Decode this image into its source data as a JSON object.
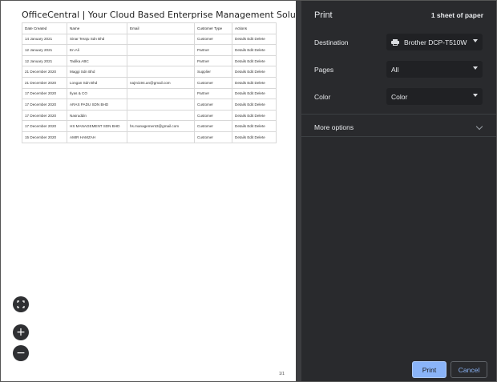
{
  "document": {
    "title": "OfficeCentral | Your Cloud Based Enterprise Management Solution",
    "columns": [
      "Date Created",
      "Name",
      "Email",
      "Customer Type",
      "Actions"
    ],
    "rows": [
      [
        "14 January 2021",
        "Sinar Teraju Sdn Bhd",
        "",
        "Customer",
        "Details Edit Delete"
      ],
      [
        "12 January 2021",
        "En Ali",
        "",
        "Partner",
        "Details Edit Delete"
      ],
      [
        "12 January 2021",
        "Tadika ABC",
        "",
        "Partner",
        "Details Edit Delete"
      ],
      [
        "21 December 2020",
        "Maggi Sdn Bhd",
        "",
        "Supplier",
        "Details Edit Delete"
      ],
      [
        "21 December 2020",
        "Longan Sdn Bhd",
        "najmi194.an@gmail.com",
        "Customer",
        "Details Edit Delete"
      ],
      [
        "17 December 2020",
        "Ilyas & CO",
        "",
        "Partner",
        "Details Edit Delete"
      ],
      [
        "17 December 2020",
        "ARAS PADU SDN BHD",
        "",
        "Customer",
        "Details Edit Delete"
      ],
      [
        "17 December 2020",
        "Nasruddin",
        "",
        "Customer",
        "Details Edit Delete"
      ],
      [
        "17 December 2020",
        "HS MANAGEMENT SDN BHD",
        "hs.management3@gmail.com",
        "Customer",
        "Details Edit Delete"
      ],
      [
        "15 December 2020",
        "AMIR HAMZAH",
        "",
        "Customer",
        "Details Edit Delete"
      ]
    ],
    "page_number": "1/1"
  },
  "zoom": {
    "fit_icon": "fit-to-page-icon",
    "zoom_in": "+",
    "zoom_out": "−"
  },
  "print_panel": {
    "title": "Print",
    "sheet_count": "1 sheet of paper",
    "destination": {
      "label": "Destination",
      "value": "Brother DCP-T510W",
      "icon": "printer-icon"
    },
    "pages": {
      "label": "Pages",
      "value": "All"
    },
    "color": {
      "label": "Color",
      "value": "Color"
    },
    "more_options": "More options",
    "print_button": "Print",
    "cancel_button": "Cancel",
    "accent_color": "#8ab4f8",
    "panel_bg": "#292a2d"
  }
}
